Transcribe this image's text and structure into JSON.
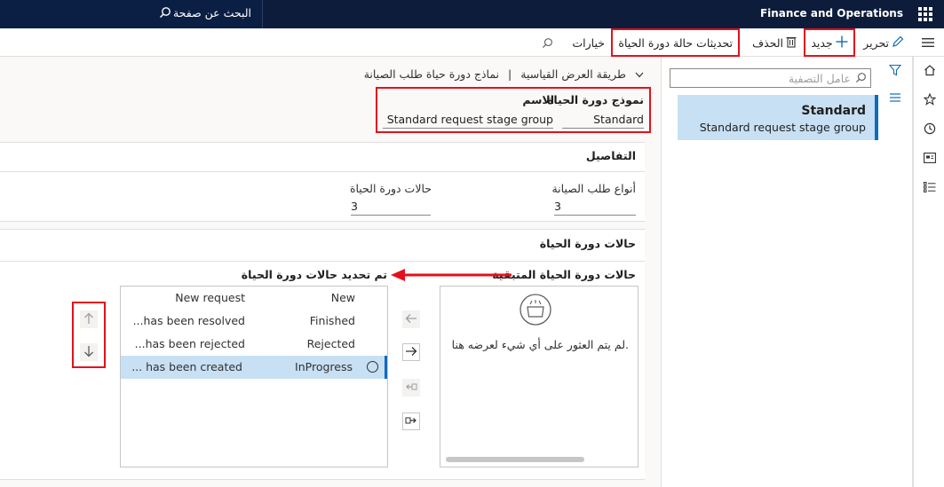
{
  "topbar": {
    "search_text": "البحث عن صفحة",
    "app_title": "Finance and Operations"
  },
  "actions": {
    "edit": "تحرير",
    "new": "جديد",
    "delete": "الحذف",
    "lifecycle_updates": "تحديثات حالة دورة الحياة",
    "options": "خيارات"
  },
  "list": {
    "filter_placeholder": "عامل التصفية",
    "items": [
      {
        "name": "Standard",
        "description": "Standard request stage group"
      }
    ]
  },
  "breadcrumb": {
    "part1": "نماذج دورة حياة طلب الصيانة",
    "separator": "|",
    "part2": "طريقة العرض القياسية"
  },
  "header": {
    "lifecycle_model_label": "نموذج دورة الحياة",
    "lifecycle_model_value": "Standard",
    "name_label": "الاسم",
    "name_value": "Standard request stage group"
  },
  "details": {
    "title": "التفاصيل",
    "request_types_label": "أنواع طلب الصيانة",
    "request_types_value": "3",
    "lifecycle_states_label": "حالات دورة الحياة",
    "lifecycle_states_value": "3"
  },
  "states": {
    "title": "حالات دورة الحياة",
    "remaining_label": "حالات دورة الحياة المتبقية",
    "selected_label": "تم تحديد حالات دورة الحياة",
    "empty_message": "لم يتم العثور على أي شيء لعرضه هنا.",
    "rows": [
      {
        "state": "New",
        "desc": "New request"
      },
      {
        "state": "Finished",
        "desc": "...has been resolved"
      },
      {
        "state": "Rejected",
        "desc": "...has been rejected"
      },
      {
        "state": "InProgress",
        "desc": "... has been created"
      }
    ]
  },
  "colors": {
    "topbar": "#0c1c3a",
    "accent": "#0f6cbd",
    "selection": "#c7e0f4",
    "highlight_box": "#e3111b"
  }
}
